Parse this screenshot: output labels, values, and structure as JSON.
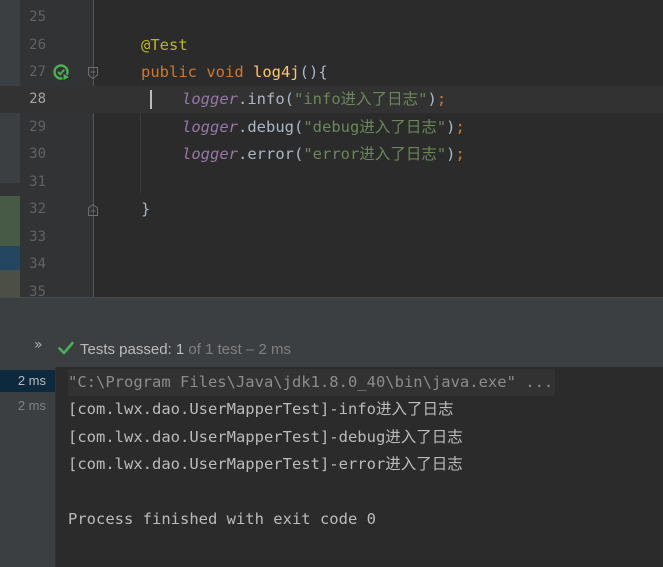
{
  "editor": {
    "lines": [
      {
        "num": "25",
        "tokens": []
      },
      {
        "num": "26",
        "tokens": [
          {
            "t": "anno",
            "v": "@Test"
          }
        ]
      },
      {
        "num": "27",
        "tokens": [
          {
            "t": "kw",
            "v": "public void "
          },
          {
            "t": "fn",
            "v": "log4j"
          },
          {
            "t": "plain",
            "v": "(){"
          }
        ]
      },
      {
        "num": "28",
        "tokens": [
          {
            "t": "field",
            "v": "logger"
          },
          {
            "t": "plain",
            "v": ".info("
          },
          {
            "t": "str",
            "v": "\"info进入了日志\""
          },
          {
            "t": "plain",
            "v": ")"
          },
          {
            "t": "semi",
            "v": ";"
          }
        ]
      },
      {
        "num": "29",
        "tokens": [
          {
            "t": "field",
            "v": "logger"
          },
          {
            "t": "plain",
            "v": ".debug("
          },
          {
            "t": "str",
            "v": "\"debug进入了日志\""
          },
          {
            "t": "plain",
            "v": ")"
          },
          {
            "t": "semi",
            "v": ";"
          }
        ]
      },
      {
        "num": "30",
        "tokens": [
          {
            "t": "field",
            "v": "logger"
          },
          {
            "t": "plain",
            "v": ".error("
          },
          {
            "t": "str",
            "v": "\"error进入了日志\""
          },
          {
            "t": "plain",
            "v": ")"
          },
          {
            "t": "semi",
            "v": ";"
          }
        ]
      },
      {
        "num": "31",
        "tokens": []
      },
      {
        "num": "32",
        "tokens": [
          {
            "t": "plain",
            "v": "}"
          }
        ]
      },
      {
        "num": "33",
        "tokens": []
      },
      {
        "num": "34",
        "tokens": []
      },
      {
        "num": "35",
        "tokens": []
      }
    ],
    "current_line": "28",
    "run_icon": "run-test-icon",
    "fold_icon": "fold-icon"
  },
  "run": {
    "expand_icon": "chevron-double-right-icon",
    "status_icon": "check-icon",
    "status_label": "Tests passed: ",
    "status_count": "1",
    "status_rest": " of 1 test – 2 ms",
    "tree_durations": [
      "2 ms",
      "2 ms"
    ],
    "console": {
      "command": "\"C:\\Program Files\\Java\\jdk1.8.0_40\\bin\\java.exe\" ...",
      "output_lines": [
        "[com.lwx.dao.UserMapperTest]-info进入了日志",
        "[com.lwx.dao.UserMapperTest]-debug进入了日志",
        "[com.lwx.dao.UserMapperTest]-error进入了日志"
      ],
      "exit_message": "Process finished with exit code 0"
    }
  },
  "colors": {
    "editor_bg": "#2b2b2b",
    "keyword": "#cc7832",
    "annotation": "#bbb529",
    "method": "#ffc66d",
    "field": "#9876aa",
    "string": "#6a8759",
    "pass_green": "#4dae53"
  }
}
